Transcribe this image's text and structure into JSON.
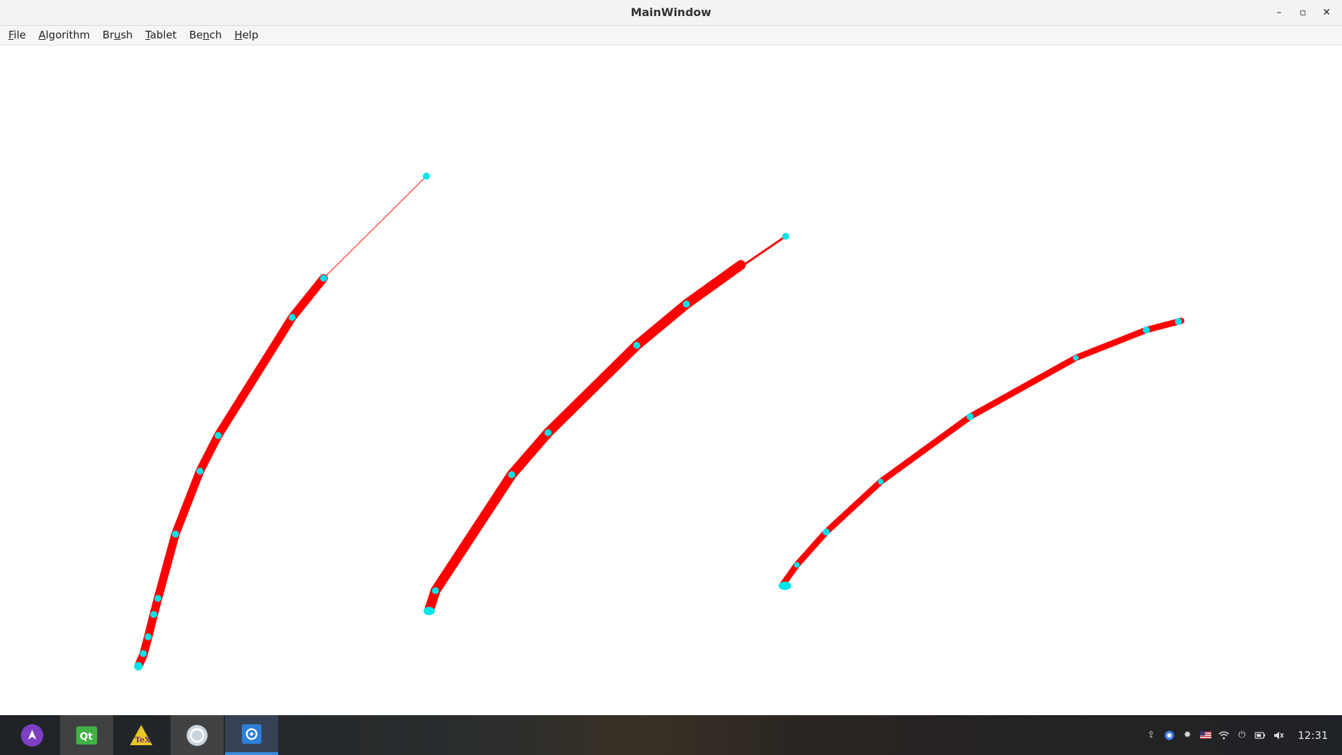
{
  "window": {
    "title": "MainWindow",
    "controls": {
      "minimize": "–",
      "maximize": "▫",
      "close": "✕"
    }
  },
  "menubar": {
    "items": [
      {
        "label": "File",
        "mnemonic": "F"
      },
      {
        "label": "Algorithm",
        "mnemonic": "A"
      },
      {
        "label": "Brush",
        "mnemonic": "u"
      },
      {
        "label": "Tablet",
        "mnemonic": "T"
      },
      {
        "label": "Bench",
        "mnemonic": "n"
      },
      {
        "label": "Help",
        "mnemonic": "H"
      }
    ]
  },
  "colors": {
    "stroke": "#ff0000",
    "control_point": "#00e5e8",
    "taskbar_active": "#3a8bd8"
  },
  "taskbar": {
    "apps": [
      {
        "name": "launcher-icon",
        "active": false
      },
      {
        "name": "qt-creator-icon",
        "active": false
      },
      {
        "name": "texmaker-icon",
        "active": false
      },
      {
        "name": "circle-app-icon",
        "active": false
      },
      {
        "name": "qt-app-icon",
        "active": true
      }
    ],
    "tray": [
      "usb-icon",
      "chrome-icon",
      "brightness-icon",
      "flag-icon",
      "wifi-icon",
      "power-icon",
      "battery-icon",
      "volume-icon"
    ],
    "clock": "12:31"
  }
}
